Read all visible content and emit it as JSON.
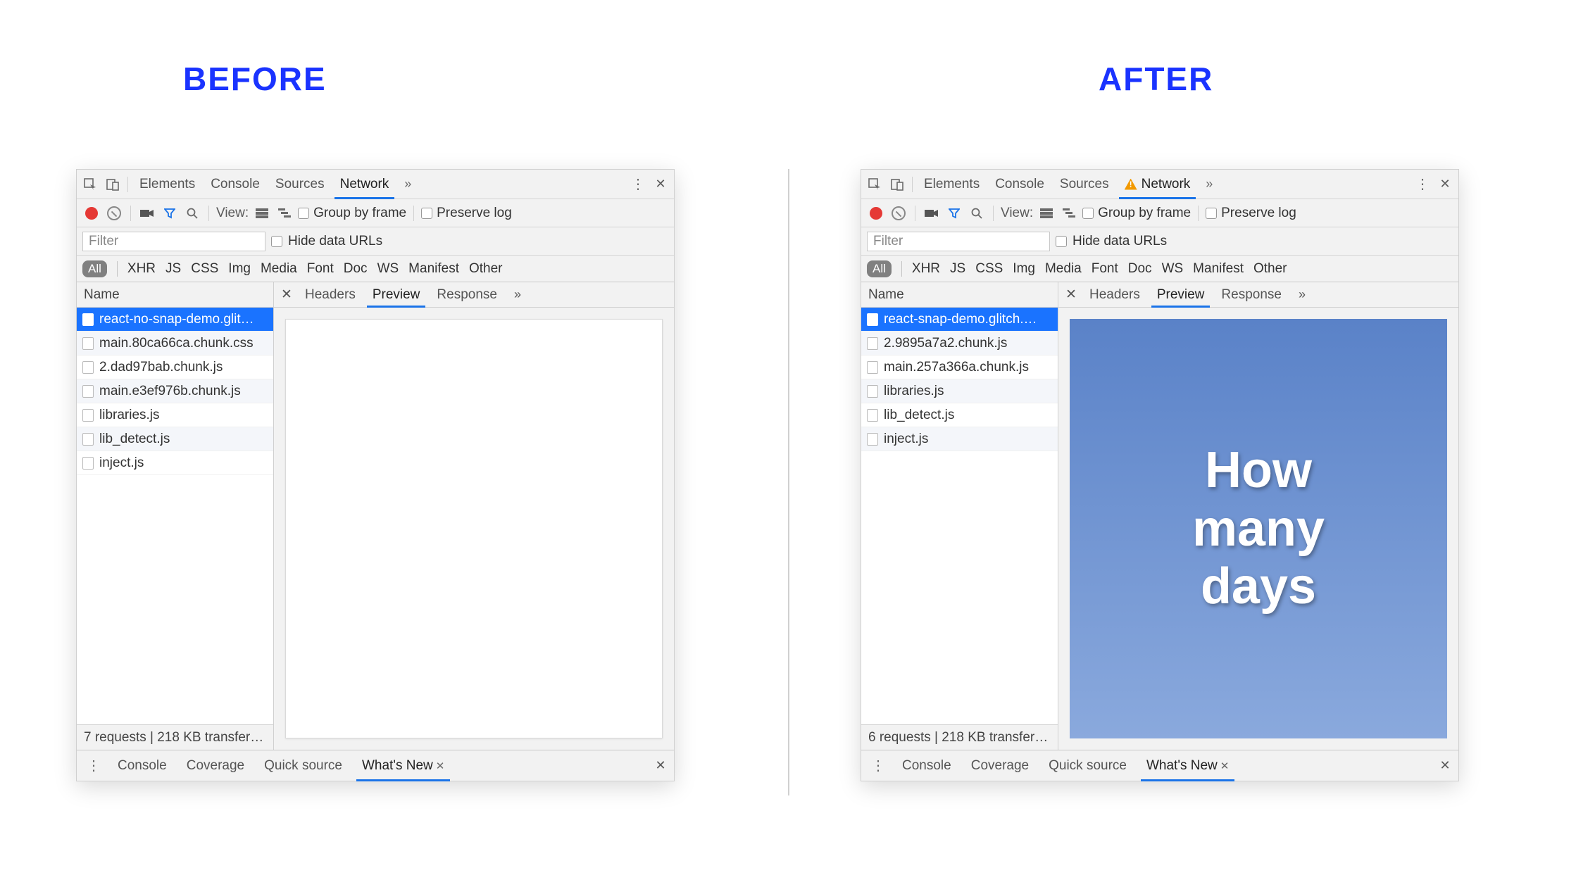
{
  "headings": {
    "before": "BEFORE",
    "after": "AFTER"
  },
  "top_tabs": [
    "Elements",
    "Console",
    "Sources",
    "Network"
  ],
  "toolbar2": {
    "view_label": "View:",
    "group_by_frame": "Group by frame",
    "preserve_log": "Preserve log"
  },
  "filter_row": {
    "placeholder": "Filter",
    "hide_data_urls": "Hide data URLs"
  },
  "type_filters": [
    "All",
    "XHR",
    "JS",
    "CSS",
    "Img",
    "Media",
    "Font",
    "Doc",
    "WS",
    "Manifest",
    "Other"
  ],
  "list_header": "Name",
  "detail_tabs": [
    "Headers",
    "Preview",
    "Response"
  ],
  "drawer_tabs": [
    "Console",
    "Coverage",
    "Quick source",
    "What's New"
  ],
  "before": {
    "has_warning": false,
    "requests": [
      "react-no-snap-demo.glit…",
      "main.80ca66ca.chunk.css",
      "2.dad97bab.chunk.js",
      "main.e3ef976b.chunk.js",
      "libraries.js",
      "lib_detect.js",
      "inject.js"
    ],
    "status": "7 requests | 218 KB transfer…",
    "preview_text": ""
  },
  "after": {
    "has_warning": true,
    "requests": [
      "react-snap-demo.glitch.…",
      "2.9895a7a2.chunk.js",
      "main.257a366a.chunk.js",
      "libraries.js",
      "lib_detect.js",
      "inject.js"
    ],
    "status": "6 requests | 218 KB transfer…",
    "preview_text": "How\nmany\ndays"
  }
}
